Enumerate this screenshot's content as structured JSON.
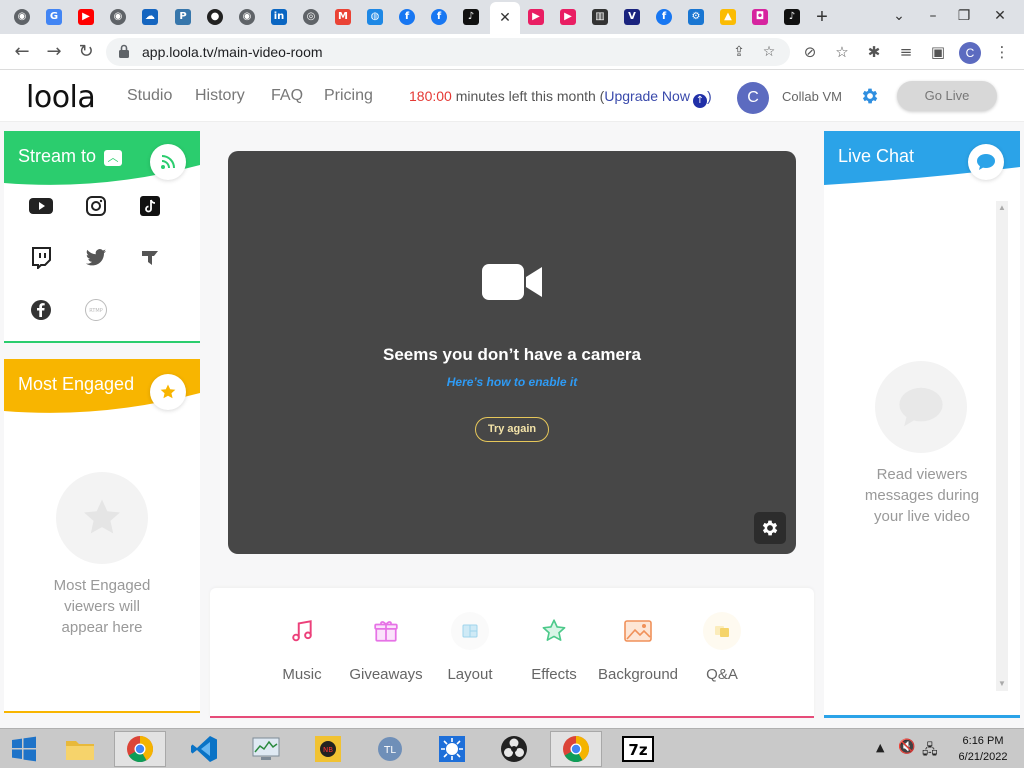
{
  "browser": {
    "tabs": [
      {
        "icon": "globe-icon",
        "glyph": "◉",
        "color": "#5f6368"
      },
      {
        "icon": "google-icon",
        "glyph": "G",
        "color": "#4285f4"
      },
      {
        "icon": "youtube-icon",
        "glyph": "▶",
        "color": "#ff0000"
      },
      {
        "icon": "globe-icon",
        "glyph": "◉",
        "color": "#5f6368"
      },
      {
        "icon": "cloud-icon",
        "glyph": "☁",
        "color": "#1565c0"
      },
      {
        "icon": "python-icon",
        "glyph": "P",
        "color": "#3776ab"
      },
      {
        "icon": "github-icon",
        "glyph": "●",
        "color": "#222222"
      },
      {
        "icon": "globe-icon",
        "glyph": "◉",
        "color": "#5f6368"
      },
      {
        "icon": "linkedin-icon",
        "glyph": "in",
        "color": "#0a66c2"
      },
      {
        "icon": "chrome-icon",
        "glyph": "◎",
        "color": "#5f6368"
      },
      {
        "icon": "gmail-icon",
        "glyph": "M",
        "color": "#ea4335"
      },
      {
        "icon": "podcast-icon",
        "glyph": "◍",
        "color": "#1e88e5"
      },
      {
        "icon": "facebook-icon",
        "glyph": "f",
        "color": "#1877f2"
      },
      {
        "icon": "facebook-icon",
        "glyph": "f",
        "color": "#1877f2"
      },
      {
        "icon": "tiktok-icon",
        "glyph": "♪",
        "color": "#111111"
      },
      {
        "icon": "close-icon",
        "glyph": "✕",
        "color": "#ffffff",
        "active": true
      },
      {
        "icon": "play-icon",
        "glyph": "▶",
        "color": "#e91e63"
      },
      {
        "icon": "play-icon",
        "glyph": "▶",
        "color": "#e91e63"
      },
      {
        "icon": "museum-icon",
        "glyph": "▥",
        "color": "#333333"
      },
      {
        "icon": "v-icon",
        "glyph": "V",
        "color": "#1a237e"
      },
      {
        "icon": "facebook-icon",
        "glyph": "f",
        "color": "#1877f2"
      },
      {
        "icon": "gear-icon",
        "glyph": "⚙",
        "color": "#1976d2"
      },
      {
        "icon": "drive-icon",
        "glyph": "▲",
        "color": "#fbbc04"
      },
      {
        "icon": "instagram-icon",
        "glyph": "◘",
        "color": "#d6249f"
      },
      {
        "icon": "tiktok-icon",
        "glyph": "♪",
        "color": "#111111"
      }
    ],
    "url": "app.loola.tv/main-video-room",
    "profile_initial": "C"
  },
  "header": {
    "logo": "loola",
    "nav": [
      "Studio",
      "History",
      "FAQ",
      "Pricing"
    ],
    "minutes_value": "180:00",
    "minutes_text": " minutes left this month (",
    "upgrade_label": "Upgrade Now",
    "upgrade_close": ")",
    "avatar_initial": "C",
    "username": "Collab VM",
    "go_live_label": "Go Live"
  },
  "stream_to": {
    "title": "Stream to",
    "platforms": [
      "youtube",
      "instagram",
      "tiktok",
      "twitch",
      "twitter",
      "trovo",
      "facebook",
      "custom-rtmp"
    ]
  },
  "most_engaged": {
    "title": "Most Engaged",
    "placeholder_line1": "Most Engaged",
    "placeholder_line2": "viewers will",
    "placeholder_line3": "appear here"
  },
  "stage": {
    "title": "Seems you don’t have a camera",
    "link": "Here’s how to enable it",
    "try_again": "Try again"
  },
  "tools": [
    {
      "label": "Music",
      "icon": "music-note-icon",
      "color": "#ec407a"
    },
    {
      "label": "Giveaways",
      "icon": "gift-icon",
      "color": "#e673e6"
    },
    {
      "label": "Layout",
      "icon": "layout-icon",
      "color": "#7ec8e3"
    },
    {
      "label": "Effects",
      "icon": "star-outline-icon",
      "color": "#4cc98a"
    },
    {
      "label": "Background",
      "icon": "image-icon",
      "color": "#f0915a"
    },
    {
      "label": "Q&A",
      "icon": "qa-icon",
      "color": "#f5d46a"
    }
  ],
  "live_chat": {
    "title": "Live Chat",
    "placeholder_line1": "Read viewers",
    "placeholder_line2": "messages during",
    "placeholder_line3": "your live video"
  },
  "colors": {
    "stream_green": "#2bcd6e",
    "engaged_yellow": "#f8b500",
    "chat_blue": "#2ba3e8",
    "stage_bg": "#474747",
    "accent_pink": "#e64c79"
  },
  "taskbar": {
    "time": "6:16 PM",
    "date": "6/21/2022"
  }
}
